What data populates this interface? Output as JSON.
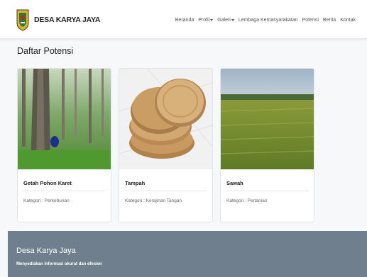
{
  "brand": {
    "name": "DESA KARYA JAYA"
  },
  "nav": {
    "items": [
      {
        "label": "Beranda",
        "dropdown": false
      },
      {
        "label": "Profil",
        "dropdown": true
      },
      {
        "label": "Galeri",
        "dropdown": true
      },
      {
        "label": "Lembaga Kemasyarakatan",
        "dropdown": false
      },
      {
        "label": "Potensi",
        "dropdown": false
      },
      {
        "label": "Berita",
        "dropdown": false
      },
      {
        "label": "Kontak",
        "dropdown": false
      }
    ]
  },
  "content": {
    "title": "Daftar Potensi",
    "cards": [
      {
        "title": "Getah Pohon Karet",
        "category": "Kategori : Perkebunan",
        "image": "rubber-tree-photo"
      },
      {
        "title": "Tampah",
        "category": "Kategori : Kerajinan Tangan",
        "image": "woven-tray-photo"
      },
      {
        "title": "Sawah",
        "category": "Kategori : Pertanian",
        "image": "rice-field-photo"
      }
    ]
  },
  "footer": {
    "title": "Desa Karya Jaya",
    "subtitle": "Menyediakan informasi akurat dan efesien"
  },
  "colors": {
    "footer_bg": "#6f7f8e",
    "page_bg": "#f7f8f9",
    "accent_logo": "#e4b322"
  }
}
